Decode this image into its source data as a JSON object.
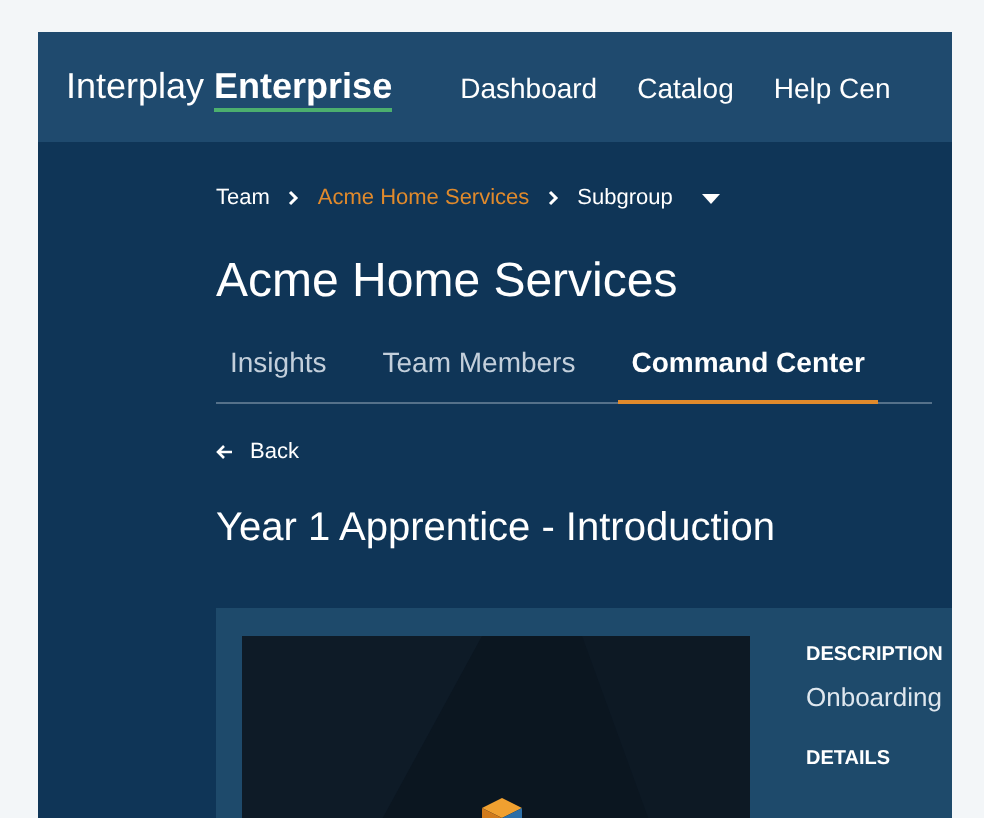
{
  "header": {
    "logo": "Interplay **Enterprise**",
    "nav": [
      "Dashboard",
      "Catalog",
      "Help Cen"
    ]
  },
  "breadcrumb": [
    {
      "label": "Team",
      "current": false
    },
    {
      "label": "Acme Home Services",
      "current": true
    },
    {
      "label": "Subgroup",
      "current": false
    }
  ],
  "title": "Acme Home Services",
  "tabs": [
    {
      "label": "Insights",
      "selected": false
    },
    {
      "label": "Team Members",
      "selected": false
    },
    {
      "label": "Command Center",
      "selected": true
    }
  ],
  "back": "Back",
  "heading": "Year 1 Apprentice - Introduction",
  "card": {
    "sections": [
      {
        "label": "DESCRIPTION",
        "value": "Onboarding"
      },
      {
        "label": "DETAILS"
      }
    ]
  }
}
